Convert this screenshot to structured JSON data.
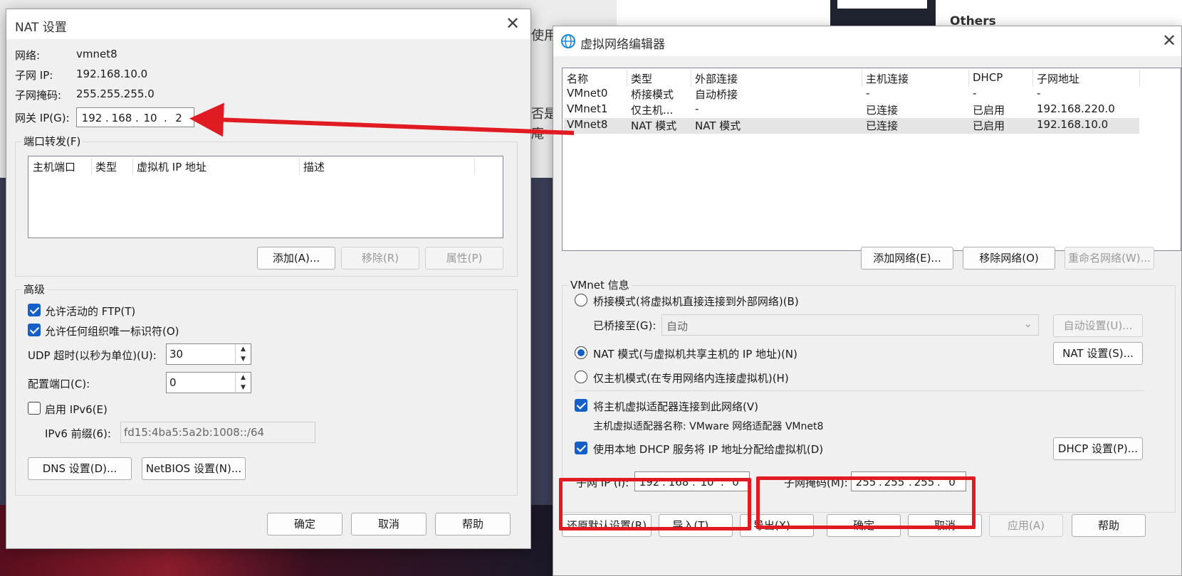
{
  "background": {
    "others_label": "Others",
    "partial_text_1": "使用",
    "partial_text_2": "否是",
    "partial_text_3": "庵"
  },
  "nat_dialog": {
    "title": "NAT 设置",
    "network_label": "网络:",
    "network_value": "vmnet8",
    "subnet_ip_label": "子网 IP:",
    "subnet_ip_value": "192.168.10.0",
    "subnet_mask_label": "子网掩码:",
    "subnet_mask_value": "255.255.255.0",
    "gateway_label": "网关 IP(G):",
    "gateway_octets": [
      "192",
      "168",
      "10",
      "2"
    ],
    "port_forward_title": "端口转发(F)",
    "port_forward_columns": [
      "主机端口",
      "类型",
      "虚拟机 IP 地址",
      "描述"
    ],
    "add_button": "添加(A)...",
    "remove_button": "移除(R)",
    "properties_button": "属性(P)",
    "advanced_title": "高级",
    "allow_ftp_label": "允许活动的 FTP(T)",
    "allow_ftp_checked": true,
    "allow_org_id_label": "允许任何组织唯一标识符(O)",
    "allow_org_id_checked": true,
    "udp_timeout_label": "UDP 超时(以秒为单位)(U):",
    "udp_timeout_value": "30",
    "config_port_label": "配置端口(C):",
    "config_port_value": "0",
    "enable_ipv6_label": "启用 IPv6(E)",
    "enable_ipv6_checked": false,
    "ipv6_prefix_label": "IPv6 前缀(6):",
    "ipv6_prefix_value": "fd15:4ba5:5a2b:1008::/64",
    "dns_button": "DNS 设置(D)...",
    "netbios_button": "NetBIOS 设置(N)...",
    "ok_button": "确定",
    "cancel_button": "取消",
    "help_button": "帮助"
  },
  "vne_dialog": {
    "title": "虚拟网络编辑器",
    "columns": [
      "名称",
      "类型",
      "外部连接",
      "主机连接",
      "DHCP",
      "子网地址"
    ],
    "rows": [
      {
        "name": "VMnet0",
        "type": "桥接模式",
        "external": "自动桥接",
        "host": "-",
        "dhcp": "-",
        "subnet": "-"
      },
      {
        "name": "VMnet1",
        "type": "仅主机...",
        "external": "-",
        "host": "已连接",
        "dhcp": "已启用",
        "subnet": "192.168.220.0"
      },
      {
        "name": "VMnet8",
        "type": "NAT 模式",
        "external": "NAT 模式",
        "host": "已连接",
        "dhcp": "已启用",
        "subnet": "192.168.10.0"
      }
    ],
    "add_network_button": "添加网络(E)...",
    "remove_network_button": "移除网络(O)",
    "rename_network_button": "重命名网络(W)...",
    "vmnet_info_title": "VMnet 信息",
    "bridged_label": "桥接模式(将虚拟机直接连接到外部网络)(B)",
    "bridged_to_label": "已桥接至(G):",
    "bridged_to_value": "自动",
    "auto_settings_button": "自动设置(U)...",
    "nat_label": "NAT 模式(与虚拟机共享主机的 IP 地址)(N)",
    "nat_settings_button": "NAT 设置(S)...",
    "host_only_label": "仅主机模式(在专用网络内连接虚拟机)(H)",
    "selected_mode": "nat",
    "connect_adapter_label": "将主机虚拟适配器连接到此网络(V)",
    "connect_adapter_checked": true,
    "adapter_name_text": "主机虚拟适配器名称: VMware 网络适配器 VMnet8",
    "use_dhcp_label": "使用本地 DHCP 服务将 IP 地址分配给虚拟机(D)",
    "use_dhcp_checked": true,
    "dhcp_settings_button": "DHCP 设置(P)...",
    "subnet_ip_label": "子网 IP (I):",
    "subnet_ip_octets": [
      "192",
      "168",
      "10",
      "0"
    ],
    "subnet_mask_label": "子网掩码(M):",
    "subnet_mask_octets": [
      "255",
      "255",
      "255",
      "0"
    ],
    "restore_defaults_button": "还原默认设置(R)",
    "import_button": "导入(T)...",
    "export_button": "导出(X)...",
    "ok_button": "确定",
    "cancel_button": "取消",
    "apply_button": "应用(A)",
    "help_button": "帮助"
  },
  "annotations": {
    "highlight_color": "#e11b22"
  }
}
